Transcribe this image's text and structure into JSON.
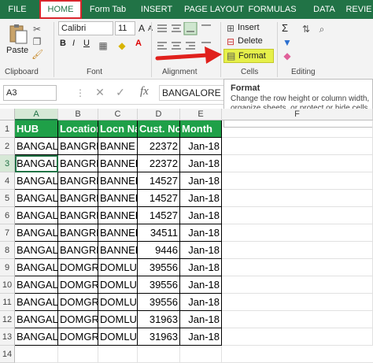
{
  "tabs": [
    "FILE",
    "HOME",
    "Form Tab",
    "INSERT",
    "PAGE LAYOUT",
    "FORMULAS",
    "DATA",
    "REVIE"
  ],
  "clipboard": {
    "paste_label": "Paste",
    "group_label": "Clipboard"
  },
  "font": {
    "name": "Calibri",
    "size": "11",
    "bold": "B",
    "italic": "I",
    "underline": "U",
    "grow": "A",
    "shrink": "A",
    "color_a": "A",
    "group_label": "Font"
  },
  "alignment": {
    "group_label": "Alignment"
  },
  "number": {
    "percent": "%"
  },
  "cells": {
    "insert_label": "Insert",
    "delete_label": "Delete",
    "format_label": "Format",
    "group_label": "Cells"
  },
  "editing": {
    "sigma": "Σ",
    "group_label": "Editing"
  },
  "tooltip": {
    "title": "Format",
    "body": "Change the row height or column width, organize sheets, or protect or hide cells."
  },
  "formula_bar": {
    "name_box": "A3",
    "fx": "fx",
    "value": "BANGALORE"
  },
  "grid": {
    "columns": [
      "A",
      "B",
      "C",
      "D",
      "E",
      "F"
    ],
    "rows": [
      "1",
      "2",
      "3",
      "4",
      "5",
      "6",
      "7",
      "8",
      "9",
      "10",
      "11",
      "12",
      "13",
      "14"
    ],
    "headers": [
      "HUB",
      "Location",
      "Locn Na",
      "Cust. No",
      "Month"
    ],
    "data": [
      [
        "BANGAL",
        "BANGRD",
        "BANNE",
        "22372",
        "Jan-18"
      ],
      [
        "BANGAL",
        "BANGRD",
        "BANNER",
        "22372",
        "Jan-18"
      ],
      [
        "BANGAL",
        "BANGRD",
        "BANNER",
        "14527",
        "Jan-18"
      ],
      [
        "BANGAL",
        "BANGRD",
        "BANNER",
        "14527",
        "Jan-18"
      ],
      [
        "BANGAL",
        "BANGRD",
        "BANNER",
        "14527",
        "Jan-18"
      ],
      [
        "BANGAL",
        "BANGRD",
        "BANNER",
        "34511",
        "Jan-18"
      ],
      [
        "BANGAL",
        "BANGRD",
        "BANNER",
        "9446",
        "Jan-18"
      ],
      [
        "BANGAL",
        "DOMGR",
        "DOMLUI",
        "39556",
        "Jan-18"
      ],
      [
        "BANGAL",
        "DOMGR",
        "DOMLUI",
        "39556",
        "Jan-18"
      ],
      [
        "BANGAL",
        "DOMGR",
        "DOMLUI",
        "39556",
        "Jan-18"
      ],
      [
        "BANGAL",
        "DOMGR",
        "DOMLUI",
        "31963",
        "Jan-18"
      ],
      [
        "BANGAL",
        "DOMGR",
        "DOMLUI",
        "31963",
        "Jan-18"
      ]
    ]
  },
  "colors": {
    "ribbon_green": "#217346",
    "header_green": "#1fa048",
    "highlight": "#e6f04a",
    "arrow_red": "#e0201c"
  }
}
